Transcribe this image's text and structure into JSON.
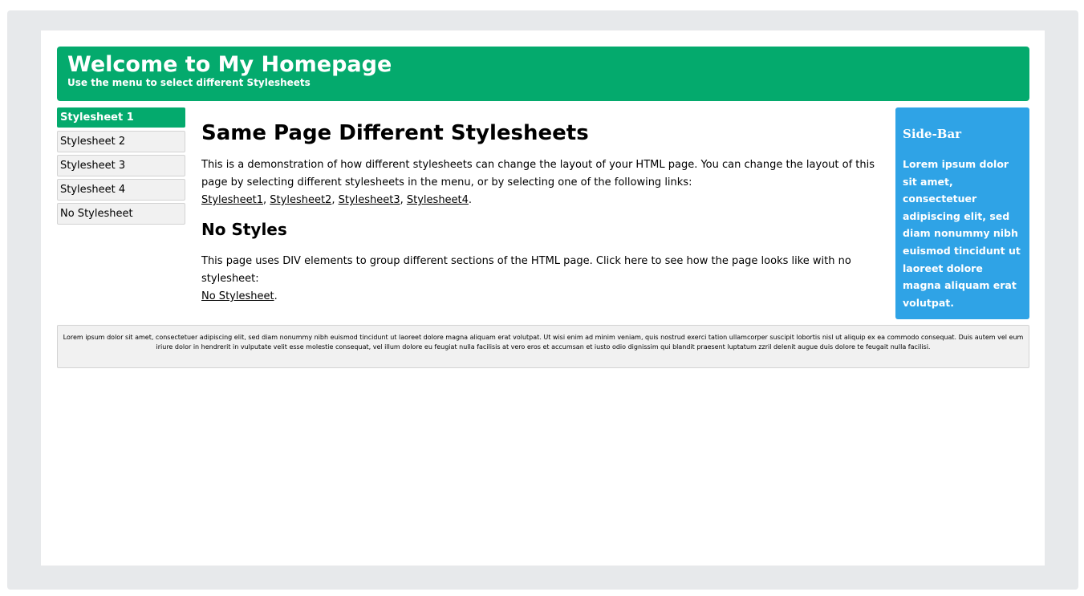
{
  "header": {
    "title": "Welcome to My Homepage",
    "subtitle": "Use the menu to select different Stylesheets"
  },
  "menu": {
    "items": [
      {
        "label": "Stylesheet 1",
        "active": true
      },
      {
        "label": "Stylesheet 2",
        "active": false
      },
      {
        "label": "Stylesheet 3",
        "active": false
      },
      {
        "label": "Stylesheet 4",
        "active": false
      },
      {
        "label": "No Stylesheet",
        "active": false
      }
    ]
  },
  "main": {
    "heading": "Same Page Different Stylesheets",
    "intro_text": "This is a demonstration of how different stylesheets can change the layout of your HTML page. You can change the layout of this page by selecting different stylesheets in the menu, or by selecting one of the following links:",
    "links": [
      "Stylesheet1",
      "Stylesheet2",
      "Stylesheet3",
      "Stylesheet4"
    ],
    "link_separator": ", ",
    "link_end": ".",
    "subheading": "No Styles",
    "no_styles_text": "This page uses DIV elements to group different sections of the HTML page. Click here to see how the page looks like with no stylesheet:",
    "no_styles_link": "No Stylesheet",
    "no_styles_end": "."
  },
  "sidebar": {
    "title": "Side-Bar",
    "text": "Lorem ipsum dolor sit amet, consectetuer adipiscing elit, sed diam nonummy nibh euismod tincidunt ut laoreet dolore magna aliquam erat volutpat."
  },
  "footer": {
    "text": "Lorem ipsum dolor sit amet, consectetuer adipiscing elit, sed diam nonummy nibh euismod tincidunt ut laoreet dolore magna aliquam erat volutpat. Ut wisi enim ad minim veniam, quis nostrud exerci tation ullamcorper suscipit lobortis nisl ut aliquip ex ea commodo consequat. Duis autem vel eum iriure dolor in hendrerit in vulputate velit esse molestie consequat, vel illum dolore eu feugiat nulla facilisis at vero eros et accumsan et iusto odio dignissim qui blandit praesent luptatum zzril delenit augue duis dolore te feugait nulla facilisi."
  },
  "colors": {
    "header_bg": "#04aa6d",
    "menu_active_bg": "#04aa6d",
    "sidebar_bg": "#2fa3e6",
    "frame_bg": "#e7e9eb",
    "menu_item_bg": "#f1f1f1"
  }
}
